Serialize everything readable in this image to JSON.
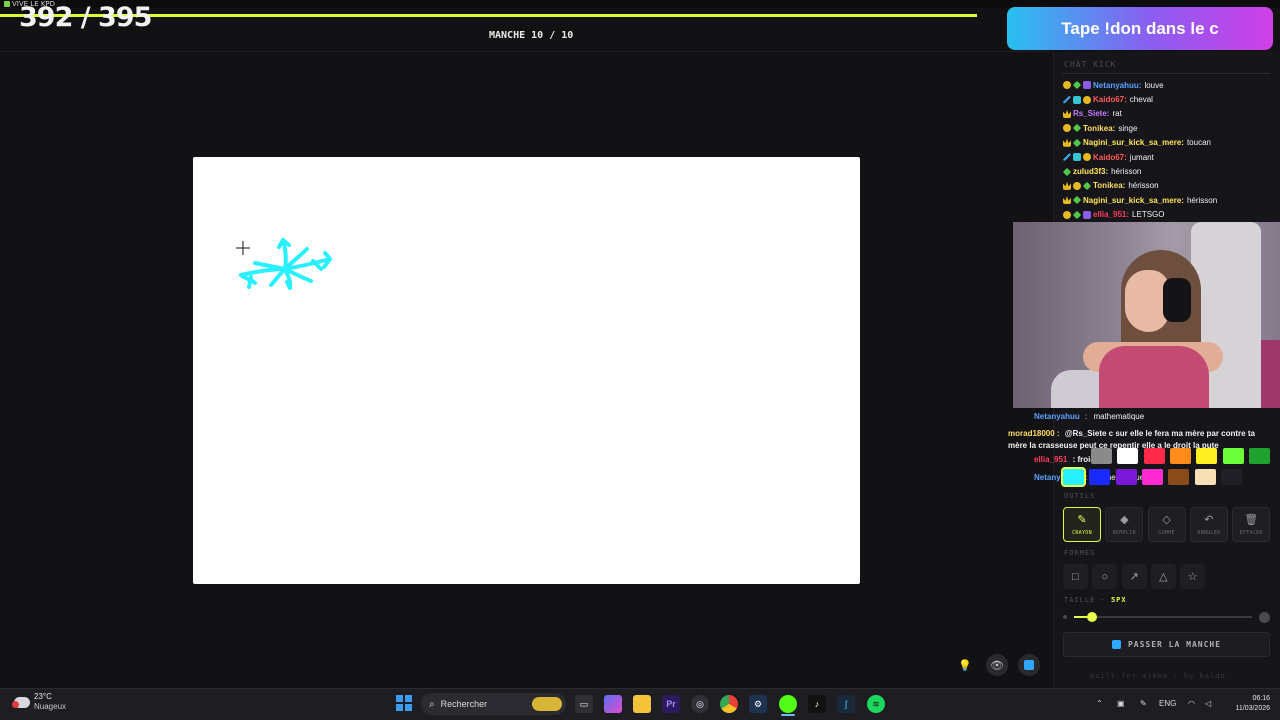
{
  "window": {
    "app_name": "VIVE LE KPD"
  },
  "header": {
    "score": "392 / 395",
    "round": "MANCHE 10 / 10"
  },
  "donation_banner": {
    "text": "Tape !don dans le c"
  },
  "chat": {
    "title": "CHAT KICK",
    "messages": [
      {
        "badges": [
          "gold",
          "green",
          "purple"
        ],
        "user": "Netanyahuu:",
        "user_color": "#5aa2ff",
        "text": "louve"
      },
      {
        "badges": [
          "sword",
          "teal",
          "gold"
        ],
        "user": "Kaido67:",
        "user_color": "#ff5a5a",
        "text": "cheval"
      },
      {
        "badges": [
          "crown"
        ],
        "user": "Rs_Siete:",
        "user_color": "#c77bff",
        "text": "rat"
      },
      {
        "badges": [
          "gold",
          "green"
        ],
        "user": "Tonikea:",
        "user_color": "#ffdd66",
        "text": "singe"
      },
      {
        "badges": [
          "crown",
          "green"
        ],
        "user": "Nagini_sur_kick_sa_mere:",
        "user_color": "#ffe45a",
        "text": "toucan"
      },
      {
        "badges": [
          "sword",
          "teal",
          "gold"
        ],
        "user": "Kaido67:",
        "user_color": "#ff5a5a",
        "text": "jumant"
      },
      {
        "badges": [
          "green"
        ],
        "user": "zulud3f3:",
        "user_color": "#ffe45a",
        "text": "hérisson"
      },
      {
        "badges": [
          "crown",
          "gold",
          "green"
        ],
        "user": "Tonikea:",
        "user_color": "#ffdd66",
        "text": "hérisson"
      },
      {
        "badges": [
          "crown",
          "green"
        ],
        "user": "Nagini_sur_kick_sa_mere:",
        "user_color": "#ffe45a",
        "text": "hérisson"
      },
      {
        "badges": [
          "gold",
          "green",
          "purple"
        ],
        "user": "ellia_951:",
        "user_color": "#ff3d5a",
        "text": "LETSGO"
      }
    ]
  },
  "lower_chat": [
    {
      "user": "Netanyahuu",
      "user_color": "#5aa2ff",
      "text": "mathematique"
    },
    {
      "user": "morad18000 :",
      "user_color": "#ffdd66",
      "text": "@Rs_Siete c sur elle le fera ma mère par contre ta mère la crasseuse peut ce repentir elle a le droit la pute"
    },
    {
      "user": "ellia_951",
      "user_color": "#ff3d5a",
      "text": "froid"
    },
    {
      "user": "Netanyahuu",
      "user_color": "#5aa2ff",
      "text": "mathematique"
    }
  ],
  "palette": {
    "row1": [
      "#8a8a8a",
      "#ffffff",
      "#ff2a4a",
      "#ff8c1a",
      "#ffee22",
      "#6bff3a",
      "#1fa12f"
    ],
    "row2": [
      "#28f0ff",
      "#1a2aff",
      "#7a1ad8",
      "#ff2ad0",
      "#8b4a1a",
      "#f7e0b5"
    ],
    "selected": "#28f0ff"
  },
  "tools": {
    "label": "OUTILS",
    "items": [
      {
        "icon": "pencil-icon",
        "label": "CRAYON",
        "active": true
      },
      {
        "icon": "fill-icon",
        "label": "REMPLIR",
        "active": false
      },
      {
        "icon": "eraser-icon",
        "label": "GOMME",
        "active": false
      },
      {
        "icon": "undo-icon",
        "label": "ANNULER",
        "active": false
      },
      {
        "icon": "trash-icon",
        "label": "EFFACER",
        "active": false
      }
    ]
  },
  "shapes": {
    "label": "FORMES",
    "items": [
      "rectangle-icon",
      "ellipse-icon",
      "arrow-icon",
      "triangle-icon",
      "star-icon"
    ]
  },
  "size": {
    "label": "TAILLE · ",
    "value": "5PX",
    "fraction": 0.1
  },
  "skip_button": {
    "label": "PASSER LA MANCHE"
  },
  "footer": {
    "text": "built for mimbe · by kaldo"
  },
  "canvas": {
    "stroke_color": "#28f0ff"
  },
  "taskbar": {
    "weather_temp": "23°C",
    "weather_desc": "Nuageux",
    "search_placeholder": "Rechercher",
    "language": "ENG",
    "time": "06:16",
    "date": "11/03/2026"
  }
}
